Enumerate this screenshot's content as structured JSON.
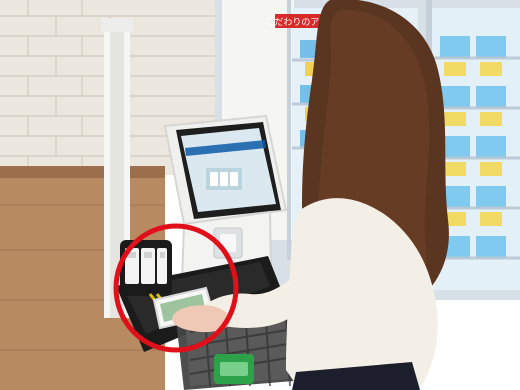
{
  "scene": {
    "kiosk": {
      "screen_text_lines": [
        "",
        "",
        ""
      ]
    },
    "store": {
      "shelf_sign": "こだわりのアイス"
    }
  },
  "colors": {
    "highlight_ring": "#e0101a",
    "kiosk_body": "#f1f1ef",
    "kiosk_screen": "#d7e6ef",
    "hair": "#5a3520",
    "sweater": "#f3efe6",
    "brick_wall": "#e9e4dc",
    "wood_panel": "#b8875e",
    "basket": "#3a3a3a",
    "cooler_frame": "#c8d2dc"
  }
}
